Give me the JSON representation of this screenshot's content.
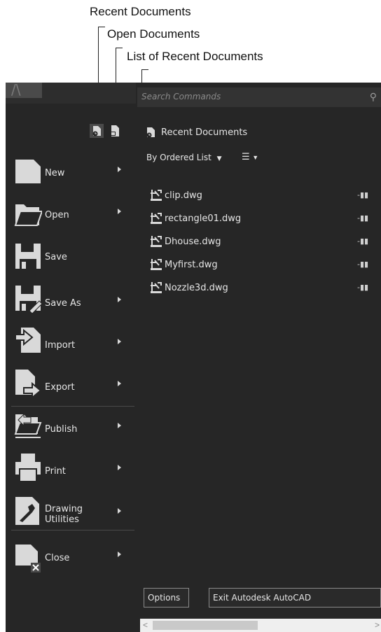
{
  "callouts": {
    "recent_documents": "Recent Documents",
    "open_documents": "Open Documents",
    "list_of_recent_documents": "List of Recent Documents"
  },
  "search": {
    "placeholder": "Search Commands"
  },
  "menu": [
    {
      "label": "New",
      "icon": "new-document-icon",
      "has_submenu": true
    },
    {
      "label": "Open",
      "icon": "folder-open-icon",
      "has_submenu": true
    },
    {
      "label": "Save",
      "icon": "save-icon",
      "has_submenu": false
    },
    {
      "label": "Save As",
      "icon": "save-as-icon",
      "has_submenu": true
    },
    {
      "label": "Import",
      "icon": "import-icon",
      "has_submenu": true
    },
    {
      "label": "Export",
      "icon": "export-icon",
      "has_submenu": true
    },
    {
      "label": "Publish",
      "icon": "publish-icon",
      "has_submenu": true
    },
    {
      "label": "Print",
      "icon": "printer-icon",
      "has_submenu": true
    },
    {
      "label_line1": "Drawing",
      "label_line2": "Utilities",
      "icon": "drawing-utilities-icon",
      "has_submenu": true
    },
    {
      "label": "Close",
      "icon": "close-document-icon",
      "has_submenu": true
    }
  ],
  "recent_panel": {
    "title": "Recent Documents",
    "sort_label": "By Ordered List",
    "documents": [
      "clip.dwg",
      "rectangle01.dwg",
      "Dhouse.dwg",
      "Myfirst.dwg",
      "Nozzle3d.dwg"
    ]
  },
  "footer": {
    "options_label": "Options",
    "exit_label": "Exit Autodesk AutoCAD"
  },
  "scrollbar": {
    "left": "<",
    "right": ">"
  },
  "colors": {
    "panel_bg": "#262626",
    "text": "#e6e6e6",
    "icon_light": "#d9d9d9",
    "accent_red": "#d94a3a"
  }
}
